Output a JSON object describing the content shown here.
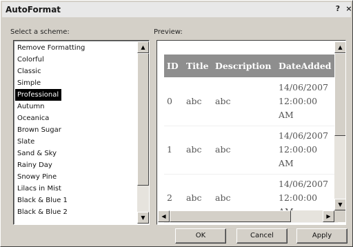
{
  "window": {
    "title": "AutoFormat",
    "help_glyph": "?",
    "close_glyph": "×"
  },
  "labels": {
    "select_scheme": "Select a scheme:",
    "preview": "Preview:"
  },
  "schemes": [
    {
      "label": "Remove Formatting",
      "selected": false
    },
    {
      "label": "Colorful",
      "selected": false
    },
    {
      "label": "Classic",
      "selected": false
    },
    {
      "label": "Simple",
      "selected": false
    },
    {
      "label": "Professional",
      "selected": true
    },
    {
      "label": "Autumn",
      "selected": false
    },
    {
      "label": "Oceanica",
      "selected": false
    },
    {
      "label": "Brown Sugar",
      "selected": false
    },
    {
      "label": "Slate",
      "selected": false
    },
    {
      "label": "Sand & Sky",
      "selected": false
    },
    {
      "label": "Rainy Day",
      "selected": false
    },
    {
      "label": "Snowy Pine",
      "selected": false
    },
    {
      "label": "Lilacs in Mist",
      "selected": false
    },
    {
      "label": "Black & Blue 1",
      "selected": false
    },
    {
      "label": "Black & Blue 2",
      "selected": false
    }
  ],
  "preview": {
    "columns": [
      "ID",
      "Title",
      "Description",
      "DateAdded"
    ],
    "rows": [
      {
        "id": "0",
        "title": "abc",
        "description": "abc",
        "date_line1": "14/06/2007",
        "date_line2": "12:00:00",
        "date_line3": "AM"
      },
      {
        "id": "1",
        "title": "abc",
        "description": "abc",
        "date_line1": "14/06/2007",
        "date_line2": "12:00:00",
        "date_line3": "AM"
      },
      {
        "id": "2",
        "title": "abc",
        "description": "abc",
        "date_line1": "14/06/2007",
        "date_line2": "12:00:00",
        "date_line3": "AM"
      }
    ],
    "header_color": "#8e8e8e"
  },
  "scroll_glyphs": {
    "up": "▲",
    "down": "▼",
    "left": "◀",
    "right": "▶"
  },
  "buttons": {
    "ok": "OK",
    "cancel": "Cancel",
    "apply": "Apply"
  }
}
